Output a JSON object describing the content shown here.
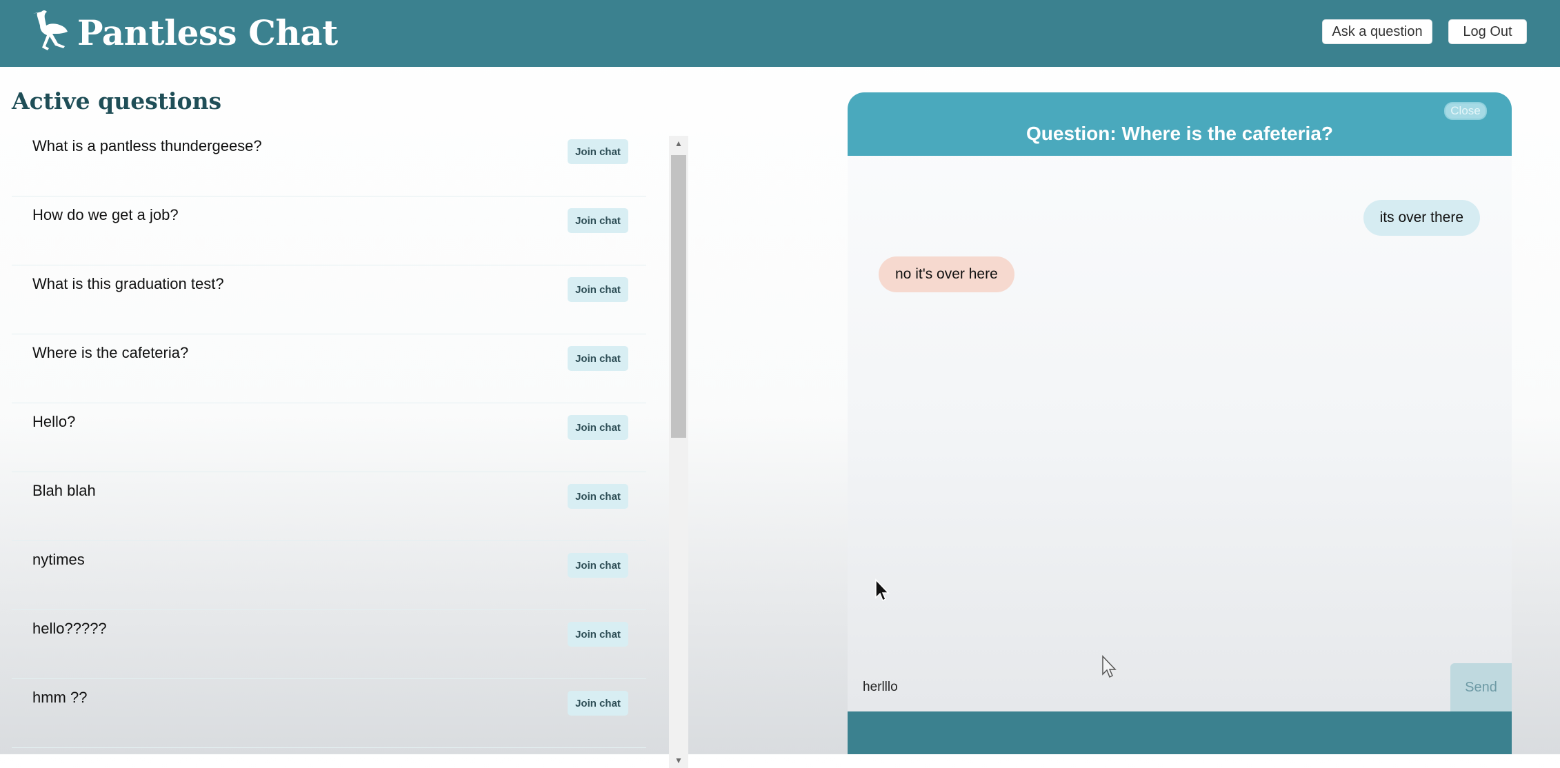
{
  "header": {
    "brand": "Pantless Chat",
    "logo_icon": "ostrich-icon",
    "ask_button": "Ask a question",
    "logout_button": "Log Out"
  },
  "questions": {
    "title": "Active questions",
    "join_label": "Join chat",
    "items": [
      "What is a pantless thundergeese?",
      "How do we get a job?",
      "What is this graduation test?",
      "Where is the cafeteria?",
      "Hello?",
      "Blah blah",
      "nytimes",
      "hello?????",
      "hmm ??"
    ]
  },
  "chat": {
    "title": "Question: Where is the cafeteria?",
    "close_label": "Close",
    "messages": [
      {
        "text": "its over there",
        "side": "outgoing"
      },
      {
        "text": "no it's over here",
        "side": "incoming"
      }
    ],
    "input_value": "herlllo",
    "send_label": "Send"
  },
  "colors": {
    "header_bg": "#3b818f",
    "chat_header_bg": "#4aa9bd",
    "outgoing_bubble": "#d6ecf2",
    "incoming_bubble": "#f6d9cf",
    "join_button_bg": "#d8eef3"
  }
}
